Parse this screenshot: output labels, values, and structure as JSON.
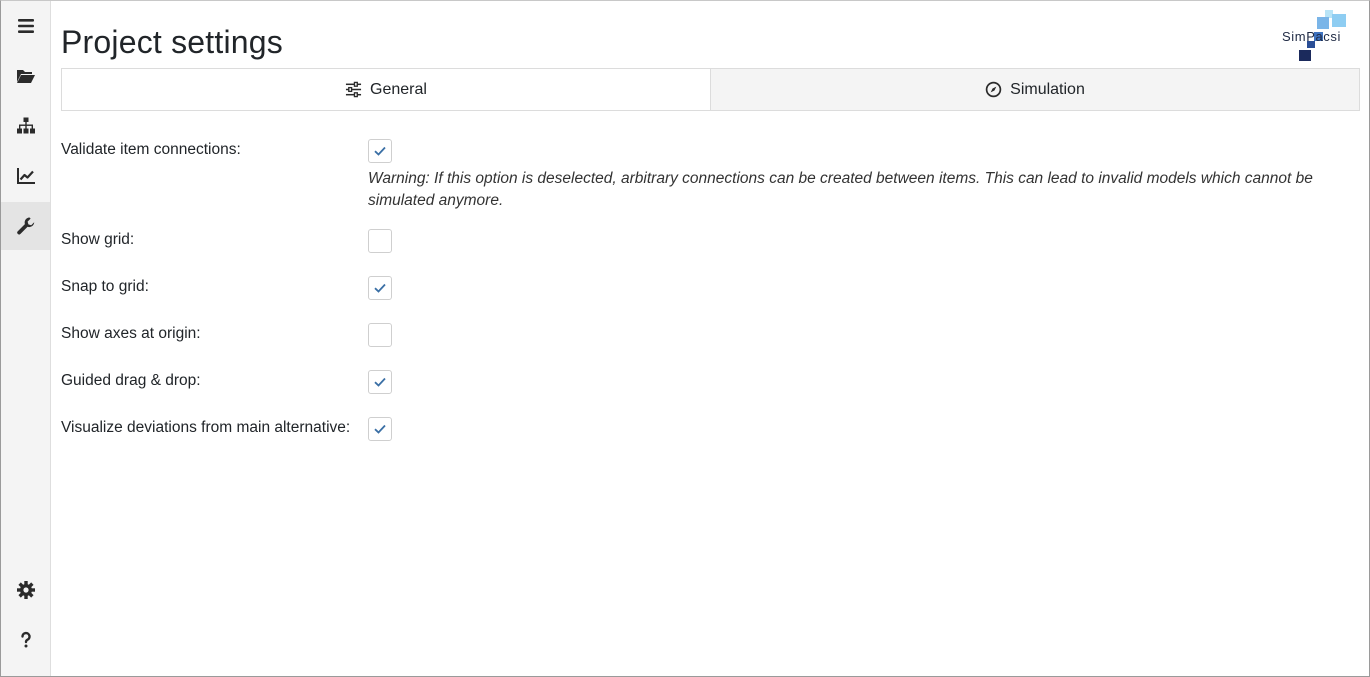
{
  "sidebar": {
    "items": [
      {
        "name": "menu-icon"
      },
      {
        "name": "folder-open-icon"
      },
      {
        "name": "sitemap-icon"
      },
      {
        "name": "chart-line-icon"
      },
      {
        "name": "wrench-icon",
        "active": true
      },
      {
        "name": "gear-icon"
      },
      {
        "name": "question-icon"
      }
    ]
  },
  "header": {
    "title": "Project settings",
    "logo_text": "SimPacsi"
  },
  "tabs": [
    {
      "label": "General",
      "icon": "sliders-icon",
      "active": true
    },
    {
      "label": "Simulation",
      "icon": "compass-icon",
      "active": false
    }
  ],
  "settings": [
    {
      "label": "Validate item connections:",
      "checked": true
    },
    {
      "label": "Show grid:",
      "checked": false
    },
    {
      "label": "Snap to grid:",
      "checked": true
    },
    {
      "label": "Show axes at origin:",
      "checked": false
    },
    {
      "label": "Guided drag & drop:",
      "checked": true
    },
    {
      "label": "Visualize deviations from main alternative:",
      "checked": true
    }
  ],
  "warning": "Warning: If this option is deselected, arbitrary connections can be created between items. This can lead to invalid models which cannot be simulated anymore.",
  "colors": {
    "check": "#3a6fa5",
    "icon": "#2b2b2b",
    "logo_dark": "#1b2a5c",
    "logo_light": "#8ec5f0"
  }
}
